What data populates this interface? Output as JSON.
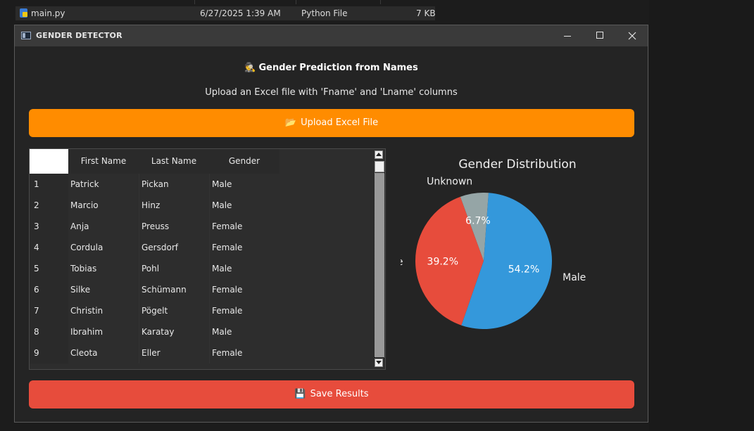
{
  "explorer": {
    "file_name": "main.py",
    "modified": "6/27/2025 1:39 AM",
    "type": "Python File",
    "size": "7 KB"
  },
  "window": {
    "title": "GENDER DETECTOR",
    "heading_icon": "🕵",
    "heading": "Gender Prediction from Names",
    "subtitle": "Upload an Excel file with 'Fname' and 'Lname' columns",
    "upload_icon": "📂",
    "upload_label": "Upload Excel File",
    "save_icon": "💾",
    "save_label": "Save Results"
  },
  "table": {
    "columns": [
      "First Name",
      "Last Name",
      "Gender"
    ],
    "rows": [
      {
        "idx": "1",
        "first": "Patrick",
        "last": "Pickan",
        "gender": "Male"
      },
      {
        "idx": "2",
        "first": "Marcio",
        "last": "Hinz",
        "gender": "Male"
      },
      {
        "idx": "3",
        "first": "Anja",
        "last": "Preuss",
        "gender": "Female"
      },
      {
        "idx": "4",
        "first": "Cordula",
        "last": "Gersdorf",
        "gender": "Female"
      },
      {
        "idx": "5",
        "first": "Tobias",
        "last": "Pohl",
        "gender": "Male"
      },
      {
        "idx": "6",
        "first": "Silke",
        "last": "Schümann",
        "gender": "Female"
      },
      {
        "idx": "7",
        "first": "Christin",
        "last": "Pögelt",
        "gender": "Female"
      },
      {
        "idx": "8",
        "first": "Ibrahim",
        "last": "Karatay",
        "gender": "Male"
      },
      {
        "idx": "9",
        "first": "Cleota",
        "last": "Eller",
        "gender": "Female"
      }
    ]
  },
  "chart_data": {
    "type": "pie",
    "title": "Gender Distribution",
    "categories": [
      "Female",
      "Male",
      "Unknown"
    ],
    "values": [
      39.2,
      54.2,
      6.7
    ],
    "labels": [
      "39.2%",
      "54.2%",
      "6.7%"
    ],
    "colors": [
      "#e74c3c",
      "#3498db",
      "#95a5a6"
    ]
  }
}
